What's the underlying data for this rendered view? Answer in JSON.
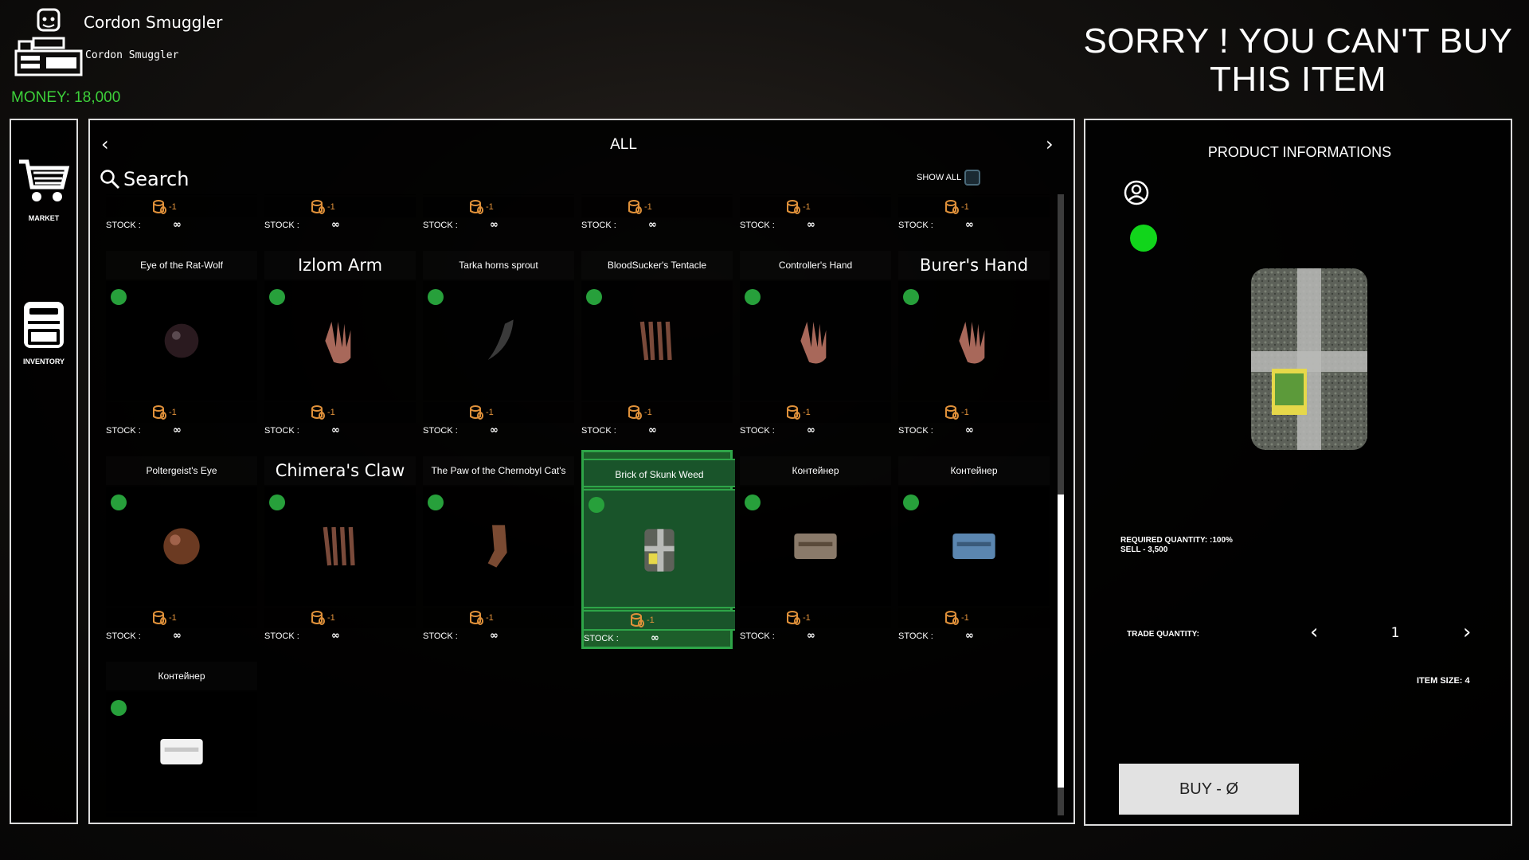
{
  "header": {
    "trader_name": "Cordon Smuggler",
    "trader_subtitle": "Cordon Smuggler",
    "money": "MONEY: 18,000",
    "notice": "SORRY ! YOU CAN'T BUY THIS ITEM"
  },
  "sidebar": {
    "items": [
      {
        "label": "MARKET",
        "icon": "cart-icon"
      },
      {
        "label": "INVENTORY",
        "icon": "backpack-icon"
      }
    ]
  },
  "market": {
    "category": "ALL",
    "search_label": "Search",
    "show_all_label": "SHOW ALL",
    "stock_label": "STOCK :",
    "stock_value": "∞",
    "price_value": "-1",
    "items": [
      {
        "name": "",
        "icon": "unknown-item"
      },
      {
        "name": "",
        "icon": "unknown-item"
      },
      {
        "name": "",
        "icon": "unknown-item"
      },
      {
        "name": "",
        "icon": "unknown-item"
      },
      {
        "name": "",
        "icon": "unknown-item"
      },
      {
        "name": "",
        "icon": "unknown-item"
      },
      {
        "name": "Eye of the Rat-Wolf",
        "icon": "dark-sphere-icon"
      },
      {
        "name": "Izlom Arm",
        "icon": "hand-icon"
      },
      {
        "name": "Tarka horns sprout",
        "icon": "horn-icon"
      },
      {
        "name": "BloodSucker's Tentacle",
        "icon": "claw-icon"
      },
      {
        "name": "Controller's Hand",
        "icon": "hand-icon"
      },
      {
        "name": "Burer's Hand",
        "icon": "hand-icon"
      },
      {
        "name": "Poltergeist's Eye",
        "icon": "brown-sphere-icon"
      },
      {
        "name": "Chimera's Claw",
        "icon": "claw-icon"
      },
      {
        "name": "The Paw of the Chernobyl Cat's",
        "icon": "paw-icon"
      },
      {
        "name": "Brick of Skunk Weed",
        "icon": "brick-icon"
      },
      {
        "name": "Контейнер",
        "icon": "crate-icon"
      },
      {
        "name": "Контейнер",
        "icon": "blue-case-icon"
      },
      {
        "name": "Контейнер",
        "icon": "white-case-icon"
      }
    ]
  },
  "product": {
    "title": "PRODUCT INFORMATIONS",
    "required_quantity": "REQUIRED QUANTITY: :100%",
    "sell": "SELL - 3,500",
    "trade_quantity_label": "TRADE QUANTITY:",
    "trade_quantity": "1",
    "item_size": "ITEM SIZE: 4",
    "buy_label": "BUY  - Ø"
  },
  "colors": {
    "money": "#3dd13a",
    "selected": "#1d5e2a",
    "status_dot": "#27a03b",
    "price": "#e0913a"
  }
}
